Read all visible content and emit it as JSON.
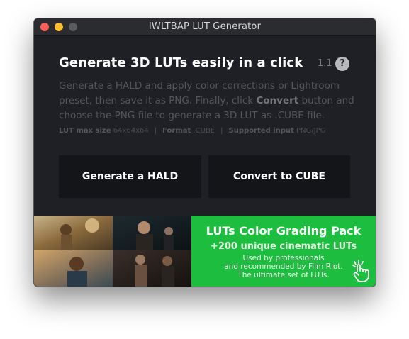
{
  "window": {
    "title": "IWLTBAP LUT Generator"
  },
  "main": {
    "headline": "Generate 3D LUTs easily in a click",
    "version": "1.1",
    "help_label": "?",
    "description_pre": "Generate a HALD and apply color corrections or Lightroom preset, then save it as PNG. Finally, click ",
    "description_bold": "Convert",
    "description_post": " button and choose the PNG file to generate a 3D LUT as .CUBE file.",
    "meta": {
      "lut_size_label": "LUT max size",
      "lut_size_value": "64x64x64",
      "format_label": "Format",
      "format_value": ".CUBE",
      "input_label": "Supported input",
      "input_value": "PNG/JPG",
      "separator": "|"
    },
    "buttons": {
      "hald_label": "Generate a HALD",
      "cube_label": "Convert to CUBE"
    }
  },
  "banner": {
    "title": "LUTs Color Grading Pack",
    "subtitle": "+200 unique cinematic LUTs",
    "line1": "Used by professionals",
    "line2": "and recommended by Film Riot.",
    "line3": "The ultimate set of LUTs."
  },
  "colors": {
    "window_bg": "#1f2025",
    "button_bg": "#141519",
    "promo_green": "#1dbe3f"
  }
}
